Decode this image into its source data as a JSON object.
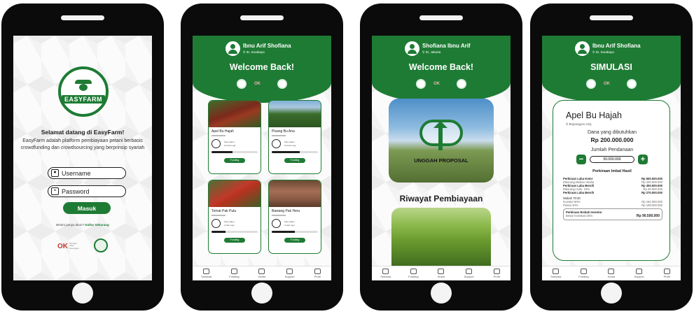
{
  "login": {
    "logo_text": "EASYFARM",
    "welcome": "Selamat datang di EasyFarm!",
    "description": "EasyFarm adalah platform pembiayaan petani berbasis crowdfunding dan crowdsourcing yang berprinsip syariah",
    "username_placeholder": "Username",
    "password_placeholder": "Password",
    "login_button": "Masuk",
    "register_prompt": "Belum punya akun?",
    "register_link": "Daftar Sekarang",
    "ojk_mark": "OK",
    "ojk_text": "Otoritas Jasa Keuangan"
  },
  "funding_screen": {
    "user_name": "Ibnu Arif Shofiana",
    "user_location": "ID, Surabaya",
    "welcome": "Welcome Back!",
    "header_ojk": "OK",
    "cards": [
      {
        "title": "Apel Bu Hajah",
        "meta1": "Sisa waktu",
        "meta2": "12 Hari Lagi",
        "progress": 0.45,
        "button": "Funding",
        "photo": "ph-apple"
      },
      {
        "title": "Pisang Bu Ana",
        "meta1": "Sisa waktu",
        "meta2": "10 Hari Lagi",
        "progress": 0.6,
        "button": "Funding",
        "photo": "ph-chili"
      },
      {
        "title": "Tomat Pak Putu",
        "meta1": "Sisa waktu",
        "meta2": "2 Hari Lagi",
        "progress": 0.3,
        "button": "Funding",
        "photo": "ph-tomato"
      },
      {
        "title": "Bawang Pak Heru",
        "meta1": "Sisa waktu",
        "meta2": "3 Hari Lagi",
        "progress": 0.5,
        "button": "Funding",
        "photo": "ph-onion"
      }
    ]
  },
  "home_screen": {
    "user_name": "Shofiana Ibnu Arif",
    "user_location": "ID, Jakarta",
    "welcome": "Welcome Back!",
    "header_ojk": "OK",
    "upload_label": "UNGGAH PROPOSAL",
    "history_title": "Riwayat Pembiayaan"
  },
  "sim_screen": {
    "user_name": "Ibnu Arif Shofiana",
    "user_location": "ID, Surabaya",
    "title": "SIMULASI",
    "header_ojk": "OK",
    "project": "Apel Bu Hajah",
    "location": "Bojonegoro City",
    "fund_label": "Dana yang dibutuhkan",
    "fund_value": "Rp 200.000.000",
    "amount_label": "Jumlah Pendanaan",
    "amount_value": "50.000.000",
    "minus": "−",
    "plus": "+",
    "section_title": "Perkiraan Imbal Hasil",
    "lines": [
      {
        "k": "Perkiraan Laba Kotor",
        "v": "Rp 500.000.000",
        "style": "b"
      },
      {
        "k": "Dikurangi Beban Usaha",
        "v": "Rp 200.000.000",
        "style": "s"
      },
      {
        "k": "Perkiraan Laba Bersih",
        "v": "Rp 300.000.000",
        "style": "b"
      },
      {
        "k": "Dikurangi Adm. 10%",
        "v": "Rp 30.000.000",
        "style": "s"
      },
      {
        "k": "Perkiraan Laba Bersih",
        "v": "Rp 270.000.000",
        "style": "b"
      },
      {
        "k": "Nisbah 70:30",
        "v": "",
        "style": ""
      },
      {
        "k": "Investor 60%",
        "v": "Rp 162.000.000",
        "style": "s"
      },
      {
        "k": "Petani 40%",
        "v": "Rp 108.000.000",
        "style": "s"
      }
    ],
    "investor_title": "Perkiraan Nisbah Investor",
    "investor_sub": "Besar Investasi 25%",
    "investor_value": "Rp 90.500.000"
  },
  "nav": [
    "Simulasi",
    "Funding",
    "Home",
    "Support",
    "Profil"
  ]
}
